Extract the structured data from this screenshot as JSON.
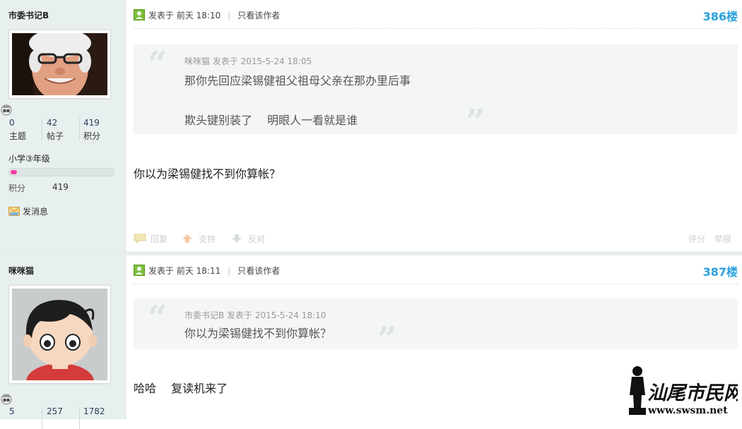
{
  "posts": [
    {
      "author": "市委书记B",
      "stats": [
        {
          "value": "0",
          "label": "主题"
        },
        {
          "value": "42",
          "label": "帖子"
        },
        {
          "value": "419",
          "label": "积分"
        }
      ],
      "grade": "小学③年级",
      "grade_progress": 0.06,
      "score_label": "积分",
      "score_value": "419",
      "message_label": "发消息",
      "posted": "发表于 前天 18:10",
      "only_author": "只看该作者",
      "floor": "386楼",
      "quote": {
        "header": "咪咪猫 发表于 2015-5-24 18:05",
        "lines": [
          "那你先回应梁锡健祖父祖母父亲在那办里后事",
          "欺头键别装了　 明眼人一看就是谁"
        ]
      },
      "body": "你以为梁锡健找不到你算帐？",
      "actions": {
        "reply": "回复",
        "support": "支持",
        "oppose": "反对",
        "rate": "评分",
        "report": "举报"
      }
    },
    {
      "author": "咪咪猫",
      "stats": [
        {
          "value": "5",
          "label": ""
        },
        {
          "value": "257",
          "label": ""
        },
        {
          "value": "1782",
          "label": ""
        }
      ],
      "posted": "发表于 前天 18:11",
      "only_author": "只看该作者",
      "floor": "387楼",
      "quote": {
        "header": "市委书记B 发表于 2015-5-24 18:10",
        "lines": [
          "你以为梁锡健找不到你算帐？"
        ]
      },
      "body": "哈哈　 复读机来了"
    }
  ],
  "watermark": {
    "logo_text": "汕尾市民网",
    "url": "www.swsm.net"
  },
  "colors": {
    "floor": "#2ba2dc",
    "sidebar_bg": "#e8efef",
    "progress": "#f23ba1",
    "quote_bg": "#f4f6f6"
  }
}
